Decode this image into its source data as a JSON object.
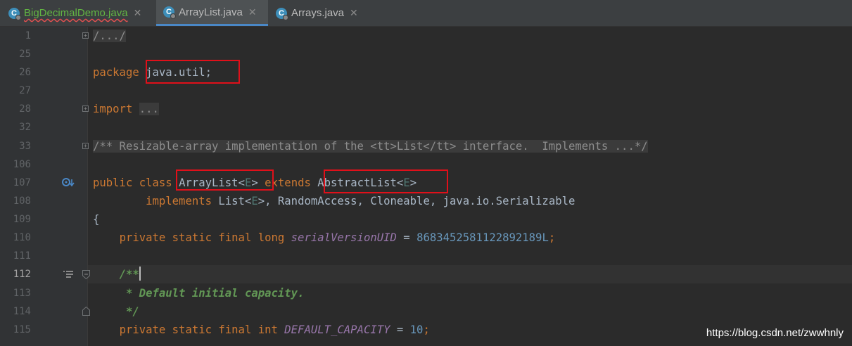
{
  "tabs": [
    {
      "label": "BigDecimalDemo.java",
      "icon": "java-class-icon",
      "active": false
    },
    {
      "label": "ArrayList.java",
      "icon": "java-class-icon",
      "active": true
    },
    {
      "label": "Arrays.java",
      "icon": "java-class-icon",
      "active": false
    }
  ],
  "gutter": {
    "line_numbers": [
      "1",
      "25",
      "26",
      "27",
      "28",
      "32",
      "33",
      "106",
      "107",
      "108",
      "109",
      "110",
      "111",
      "112",
      "113",
      "114",
      "115"
    ],
    "current_line": "112"
  },
  "code": {
    "l1": "/.../",
    "l26_kw": "package",
    "l26_pkg": "java.util;",
    "l28_kw": "import",
    "l28_fold": "...",
    "l33_doc": "/** Resizable-array implementation of the <tt>List</tt> interface.  Implements ...*/",
    "l107_kw1": "public",
    "l107_kw2": "class",
    "l107_cls": "ArrayList<",
    "l107_gen": "E",
    "l107_close": ">",
    "l107_kw3": "extends",
    "l107_sup": "AbstractList<",
    "l107_gen2": "E",
    "l107_close2": ">",
    "l108_kw": "implements",
    "l108_a": "List<",
    "l108_gen": "E",
    "l108_b": ">, RandomAccess, Cloneable, java.io.Serializable",
    "l109": "{",
    "l110_kw": "private static final long",
    "l110_field": "serialVersionUID",
    "l110_eq": " = ",
    "l110_num": "8683452581122892189L",
    "l110_semi": ";",
    "l112": "/**",
    "l113": " * Default initial capacity.",
    "l114": " */",
    "l115_kw": "private static final int",
    "l115_field": "DEFAULT_CAPACITY",
    "l115_eq": " = ",
    "l115_num": "10",
    "l115_semi": ";"
  },
  "watermark": "https://blog.csdn.net/zwwhnly"
}
